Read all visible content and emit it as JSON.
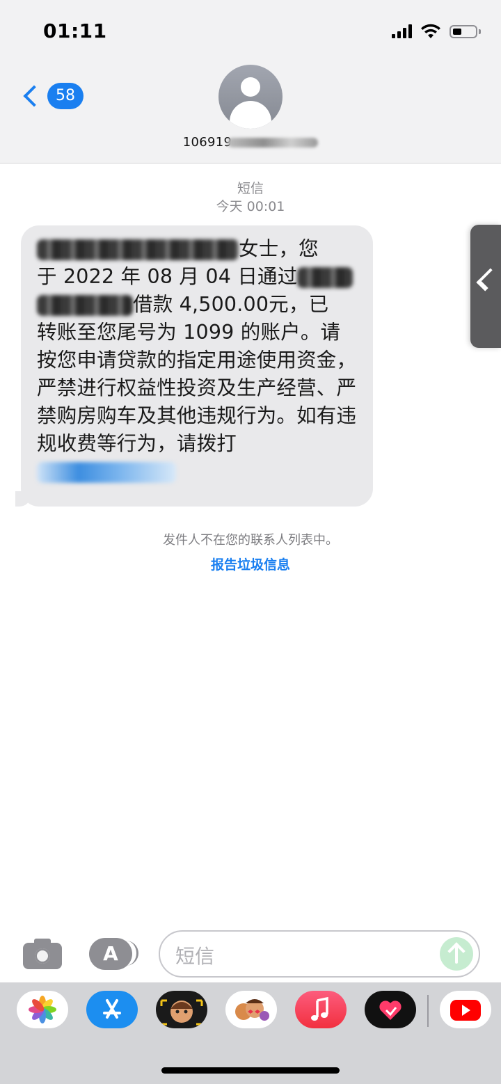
{
  "status_bar": {
    "time": "01:11"
  },
  "header": {
    "back_badge": "58",
    "contact_name": "106919"
  },
  "thread": {
    "service_label": "短信",
    "timestamp": "今天 00:01",
    "message": {
      "text_1": "女士，您",
      "text_2": "于 2022 年 08 月 04 日通过",
      "text_3": "借款 4,500.00元，已",
      "text_4": "转账至您尾号为 1099 的账户。请按您申请贷款的指定用途使用资金，严禁进行权益性投资及生产经营、严禁购房购车及其他违规行为。如有违规收费等行为，请拨打"
    },
    "notice": "发件人不在您的联系人列表中。",
    "report_link": "报告垃圾信息"
  },
  "input_bar": {
    "placeholder": "短信"
  },
  "app_drawer": {
    "apps": [
      "photos-icon",
      "app-store-icon",
      "memoji-icon",
      "animoji-icon",
      "music-icon",
      "digital-touch-icon",
      "youtube-icon"
    ]
  },
  "colors": {
    "accent": "#1a7ff0",
    "bubble": "#e9e9eb",
    "send": "#c6ecd0",
    "drawer": "#d3d4d7"
  }
}
